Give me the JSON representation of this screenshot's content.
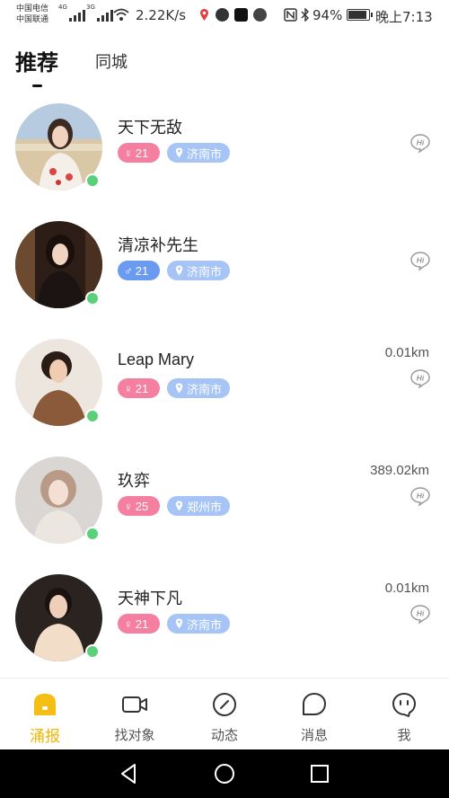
{
  "status_bar": {
    "carrier_1": "中国电信",
    "carrier_2": "中国联通",
    "net_1": "4G",
    "net_2": "3G",
    "speed": "2.22K/s",
    "battery": "94%",
    "battery_level": 0.94,
    "time": "晚上7:13"
  },
  "tabs": [
    {
      "label": "推荐",
      "active": true
    },
    {
      "label": "同城",
      "active": false
    }
  ],
  "users": [
    {
      "name": "天下无敌",
      "gender": "female",
      "age": "21",
      "city": "济南市",
      "distance": "",
      "online": true
    },
    {
      "name": "清凉补先生",
      "gender": "male",
      "age": "21",
      "city": "济南市",
      "distance": "",
      "online": true
    },
    {
      "name": "Leap Mary",
      "gender": "female",
      "age": "21",
      "city": "济南市",
      "distance": "0.01km",
      "online": true
    },
    {
      "name": "玖弈",
      "gender": "female",
      "age": "25",
      "city": "郑州市",
      "distance": "389.02km",
      "online": true
    },
    {
      "name": "天神下凡",
      "gender": "female",
      "age": "21",
      "city": "济南市",
      "distance": "0.01km",
      "online": true
    }
  ],
  "hi_label": "Hi",
  "bottom_nav": [
    {
      "label": "涌报",
      "icon": "home-icon",
      "active": true
    },
    {
      "label": "找对象",
      "icon": "video-icon",
      "active": false
    },
    {
      "label": "动态",
      "icon": "compass-icon",
      "active": false
    },
    {
      "label": "消息",
      "icon": "message-icon",
      "active": false
    },
    {
      "label": "我",
      "icon": "face-icon",
      "active": false
    }
  ],
  "colors": {
    "accent": "#f0b400",
    "female_badge": "#f47fa0",
    "male_badge": "#6b9bf0",
    "city_badge": "#a6c4f5",
    "online": "#5bd07a"
  }
}
